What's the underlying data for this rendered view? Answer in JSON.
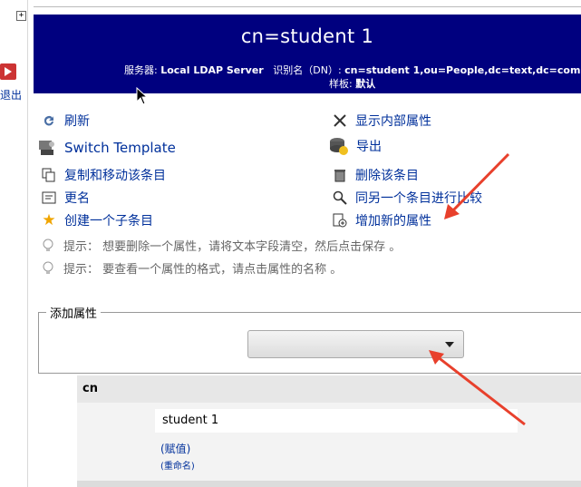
{
  "sidebar": {
    "expand": "+",
    "logout_label": "退出",
    "logout_icon": "logout-icon"
  },
  "header": {
    "title": "cn=student 1",
    "server_label": "服务器:",
    "server_value": "Local LDAP Server",
    "dn_label": "识别名（DN）:",
    "dn_value": "cn=student 1,ou=People,dc=text,dc=com",
    "template_label": "样板:",
    "template_value": "默认"
  },
  "actions": {
    "refresh": "刷新",
    "switch_template": "Switch Template",
    "copy_move": "复制和移动该条目",
    "rename": "更名",
    "create_child": "创建一个子条目",
    "show_internal": "显示内部属性",
    "export": "导出",
    "delete": "删除该条目",
    "compare": "同另一个条目进行比较",
    "add_attribute": "增加新的属性"
  },
  "hints": {
    "hint1": "提示： 想要删除一个属性，请将文本字段清空，然后点击保存 。",
    "hint2": "提示： 要查看一个属性的格式，请点击属性的名称 。"
  },
  "add_attr": {
    "legend": "添加属性",
    "selected": ""
  },
  "attribute": {
    "name": "cn",
    "value": "student 1",
    "assign_link": "(赋值)",
    "rename_link": "(重命名)"
  },
  "colors": {
    "header_bg": "#00007f",
    "link": "#00309b",
    "annotation_arrow": "#e8402c"
  }
}
